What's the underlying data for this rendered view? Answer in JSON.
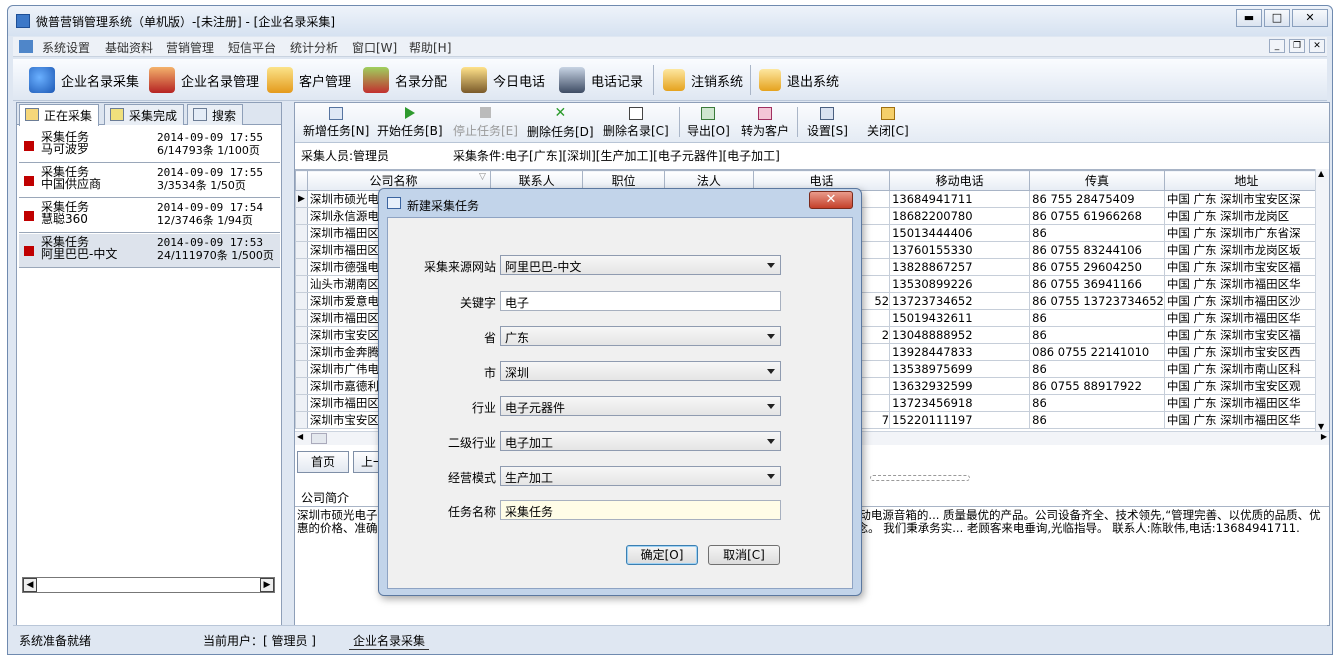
{
  "window": {
    "title": "微普营销管理系统（单机版）-[未注册] - [企业名录采集]"
  },
  "menu": [
    "系统设置",
    "基础资料",
    "营销管理",
    "短信平台",
    "统计分析",
    "窗口[W]",
    "帮助[H]"
  ],
  "toolbar": [
    "企业名录采集",
    "企业名录管理",
    "客户管理",
    "名录分配",
    "今日电话",
    "电话记录",
    "注销系统",
    "退出系统"
  ],
  "left_tabs": [
    "正在采集",
    "采集完成",
    "搜索"
  ],
  "tasks": [
    {
      "name": "采集任务",
      "site": "马可波罗",
      "date": "2014-09-09 17:55",
      "progress": "6/14793条 1/100页"
    },
    {
      "name": "采集任务",
      "site": "中国供应商",
      "date": "2014-09-09 17:55",
      "progress": "3/3534条 1/50页"
    },
    {
      "name": "采集任务",
      "site": "慧聪360",
      "date": "2014-09-09 17:54",
      "progress": "12/3746条 1/94页"
    },
    {
      "name": "采集任务",
      "site": "阿里巴巴-中文",
      "date": "2014-09-09 17:53",
      "progress": "24/111970条 1/500页"
    }
  ],
  "right_toolbar": [
    "新增任务[N]",
    "开始任务[B]",
    "停止任务[E]",
    "删除任务[D]",
    "删除名录[C]",
    "导出[O]",
    "转为客户",
    "设置[S]",
    "关闭[C]"
  ],
  "info": {
    "collector": "采集人员:管理员",
    "conditions": "采集条件:电子[广东][深圳][生产加工][电子元器件][电子加工]"
  },
  "columns": [
    "公司名称",
    "联系人",
    "职位",
    "法人",
    "电话",
    "移动电话",
    "传真",
    "地址"
  ],
  "rows": [
    {
      "company": "深圳市硕光电子",
      "mobile": "13684941711",
      "fax": "86 755 28475409",
      "addr": "中国 广东 深圳市宝安区深"
    },
    {
      "company": "深圳永信源电子",
      "mobile": "18682200780",
      "fax": "86 0755 61966268",
      "addr": "中国 广东 深圳市龙岗区"
    },
    {
      "company": "深圳市福田区九",
      "mobile": "15013444406",
      "fax": "86",
      "addr": "中国 广东 深圳市广东省深"
    },
    {
      "company": "深圳市福田区新",
      "mobile": "13760155330",
      "fax": "86 0755 83244106",
      "addr": "中国 广东 深圳市龙岗区坂"
    },
    {
      "company": "深圳市德强电子",
      "mobile": "13828867257",
      "fax": "86 0755 29604250",
      "addr": "中国 广东 深圳市宝安区福"
    },
    {
      "company": "汕头市潮南区胜",
      "mobile": "13530899226",
      "fax": "86 0755 36941166",
      "addr": "中国 广东 深圳市福田区华"
    },
    {
      "company": "深圳市爱意电子",
      "phone_tail": "52",
      "mobile": "13723734652",
      "fax": "86 0755 13723734652",
      "addr": "中国 广东 深圳市福田区沙"
    },
    {
      "company": "深圳市福田区隆",
      "mobile": "15019432611",
      "fax": "86",
      "addr": "中国 广东 深圳市福田区华"
    },
    {
      "company": "深圳市宝安区福",
      "phone_tail": "2",
      "mobile": "13048888952",
      "fax": "86",
      "addr": "中国 广东 深圳市宝安区福"
    },
    {
      "company": "深圳市金奔腾电",
      "mobile": "13928447833",
      "fax": "086 0755 22141010",
      "addr": "中国 广东 深圳市宝安区西"
    },
    {
      "company": "深圳市广伟电子商",
      "mobile": "13538975699",
      "fax": "86",
      "addr": "中国 广东 深圳市南山区科"
    },
    {
      "company": "深圳市嘉德利电",
      "mobile": "13632932599",
      "fax": "86 0755 88917922",
      "addr": "中国 广东 深圳市宝安区观"
    },
    {
      "company": "深圳市福田区华",
      "mobile": "13723456918",
      "fax": "86",
      "addr": "中国 广东 深圳市福田区华"
    },
    {
      "company": "深圳市宝安区新",
      "phone_tail": "7",
      "mobile": "15220111197",
      "fax": "86",
      "addr": "中国 广东 深圳市福田区华"
    }
  ],
  "paging": {
    "first": "首页",
    "prev": "上一"
  },
  "company_intro": {
    "title": "公司简介",
    "text": "深圳市硕光电子有限公司 卡音箱,充电器,耳机,数据线。移动电源制造厂家。致力于插卡音箱,充电器,数据线。移动电源音箱的... 质量最优的产品。公司设备齐全、技术领先,“管理完善、以优质的品质、优惠的价格、准确的交货期、服... “品质、服务、专业”为服务标准,以“人为科技之本、以科技促进文明”的经营理念。 我们秉承务实... 老顾客来电垂询,光临指导。 联系人:陈耿伟,电话:13684941711."
  },
  "status": {
    "ready": "系统准备就绪",
    "user": "当前用户：[ 管理员 ]",
    "tab": "企业名录采集"
  },
  "dialog": {
    "title": "新建采集任务",
    "labels": [
      "采集来源网站",
      "关键字",
      "省",
      "市",
      "行业",
      "二级行业",
      "经营模式",
      "任务名称"
    ],
    "source": "阿里巴巴-中文",
    "keyword": "电子",
    "province": "广东",
    "city": "深圳",
    "industry": "电子元器件",
    "sub_industry": "电子加工",
    "mode": "生产加工",
    "task_name": "采集任务",
    "ok": "确定[O]",
    "cancel": "取消[C]"
  }
}
